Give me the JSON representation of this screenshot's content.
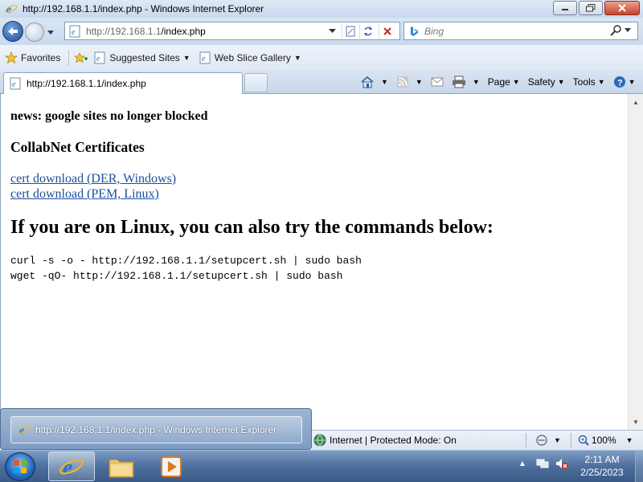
{
  "window": {
    "title": "http://192.168.1.1/index.php - Windows Internet Explorer"
  },
  "navbar": {
    "address_host": "http://192.168.1.1",
    "address_path": "/index.php",
    "search_placeholder": "Bing"
  },
  "favorites_bar": {
    "favorites_label": "Favorites",
    "items": [
      {
        "label": "Suggested Sites"
      },
      {
        "label": "Web Slice Gallery"
      }
    ]
  },
  "tabs": [
    {
      "label": "http://192.168.1.1/index.php"
    }
  ],
  "command_bar": {
    "page_label": "Page",
    "safety_label": "Safety",
    "tools_label": "Tools"
  },
  "page": {
    "news": "news: google sites no longer blocked",
    "heading_certs": "CollabNet Certificates",
    "links": [
      {
        "label": "cert download (DER, Windows)"
      },
      {
        "label": "cert download (PEM, Linux)"
      }
    ],
    "heading_linux": "If you are on Linux, you can also try the commands below:",
    "commands": [
      "curl -s -o - http://192.168.1.1/setupcert.sh | sudo bash",
      "wget -qO- http://192.168.1.1/setupcert.sh | sudo bash"
    ]
  },
  "thumbnail_popup": {
    "label": "http://192.168.1.1/index.php - Windows Internet Explorer"
  },
  "status_bar": {
    "zone": "Internet | Protected Mode: On",
    "zoom": "100%"
  },
  "taskbar": {
    "time": "2:11 AM",
    "date": "2/25/2023"
  },
  "colors": {
    "link": "#1a4f99",
    "taskbar": "#4d6f9d",
    "title_bar": "#c9d9ee"
  }
}
